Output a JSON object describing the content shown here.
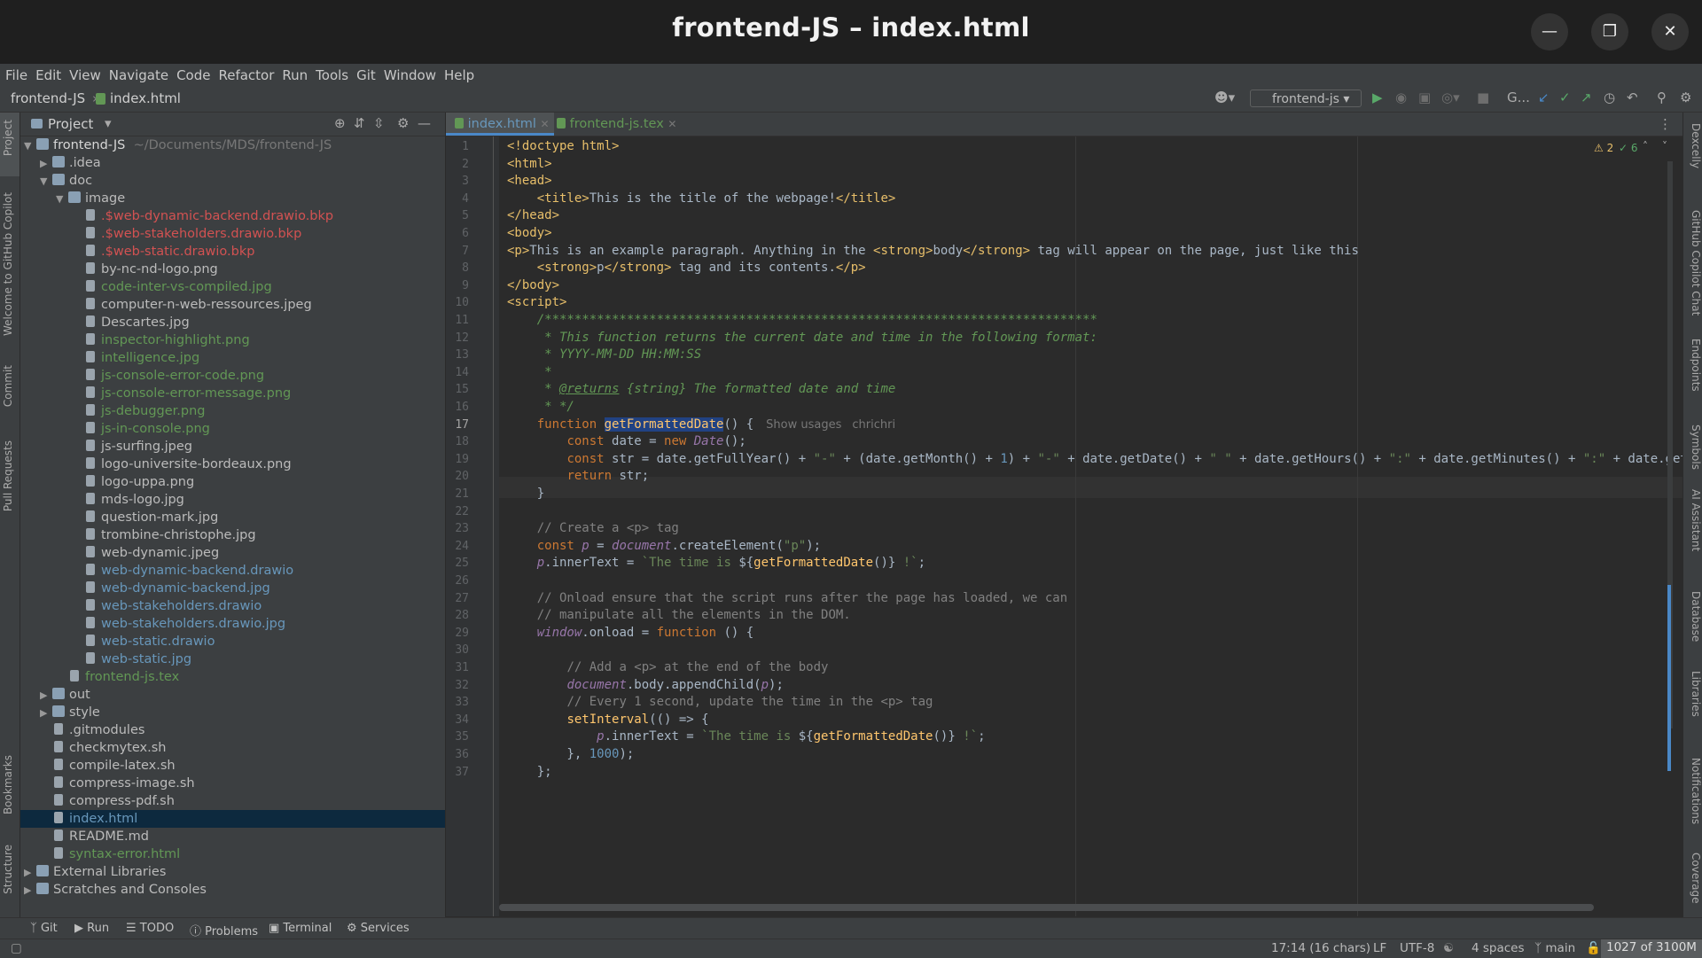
{
  "window": {
    "title": "frontend-JS – index.html"
  },
  "menu": [
    "File",
    "Edit",
    "View",
    "Navigate",
    "Code",
    "Refactor",
    "Run",
    "Tools",
    "Git",
    "Window",
    "Help"
  ],
  "breadcrumb": {
    "project": "frontend-JS",
    "file": "index.html"
  },
  "toolbar": {
    "run_config": "frontend-js",
    "git_label": "G..."
  },
  "left_tools": [
    "Project",
    "Welcome to GitHub Copilot",
    "Commit",
    "Pull Requests",
    "Bookmarks",
    "Structure"
  ],
  "right_tools": [
    "Dexcelly",
    "GitHub Copilot Chat",
    "Endpoints",
    "Symbols",
    "AI Assistant",
    "Database",
    "Libraries",
    "Notifications",
    "Coverage"
  ],
  "project_panel": {
    "title": "Project",
    "root": {
      "name": "frontend-JS",
      "path": "~/Documents/MDS/frontend-JS"
    },
    "items": [
      {
        "name": ".idea",
        "kind": "folder",
        "depth": 1,
        "arrow": "right",
        "color": "#bbbbbb"
      },
      {
        "name": "doc",
        "kind": "folder",
        "depth": 1,
        "arrow": "down",
        "color": "#bbbbbb"
      },
      {
        "name": "image",
        "kind": "folder",
        "depth": 2,
        "arrow": "down",
        "color": "#bbbbbb"
      },
      {
        "name": ".$web-dynamic-backend.drawio.bkp",
        "kind": "file",
        "depth": 3,
        "color": "#d25252"
      },
      {
        "name": ".$web-stakeholders.drawio.bkp",
        "kind": "file",
        "depth": 3,
        "color": "#d25252"
      },
      {
        "name": ".$web-static.drawio.bkp",
        "kind": "file",
        "depth": 3,
        "color": "#d25252"
      },
      {
        "name": "by-nc-nd-logo.png",
        "kind": "file",
        "depth": 3,
        "color": "#bbbbbb"
      },
      {
        "name": "code-inter-vs-compiled.jpg",
        "kind": "file",
        "depth": 3,
        "color": "#629755"
      },
      {
        "name": "computer-n-web-ressources.jpeg",
        "kind": "file",
        "depth": 3,
        "color": "#bbbbbb"
      },
      {
        "name": "Descartes.jpg",
        "kind": "file",
        "depth": 3,
        "color": "#bbbbbb"
      },
      {
        "name": "inspector-highlight.png",
        "kind": "file",
        "depth": 3,
        "color": "#629755"
      },
      {
        "name": "intelligence.jpg",
        "kind": "file",
        "depth": 3,
        "color": "#629755"
      },
      {
        "name": "js-console-error-code.png",
        "kind": "file",
        "depth": 3,
        "color": "#629755"
      },
      {
        "name": "js-console-error-message.png",
        "kind": "file",
        "depth": 3,
        "color": "#629755"
      },
      {
        "name": "js-debugger.png",
        "kind": "file",
        "depth": 3,
        "color": "#629755"
      },
      {
        "name": "js-in-console.png",
        "kind": "file",
        "depth": 3,
        "color": "#629755"
      },
      {
        "name": "js-surfing.jpeg",
        "kind": "file",
        "depth": 3,
        "color": "#bbbbbb"
      },
      {
        "name": "logo-universite-bordeaux.png",
        "kind": "file",
        "depth": 3,
        "color": "#bbbbbb"
      },
      {
        "name": "logo-uppa.png",
        "kind": "file",
        "depth": 3,
        "color": "#bbbbbb"
      },
      {
        "name": "mds-logo.jpg",
        "kind": "file",
        "depth": 3,
        "color": "#bbbbbb"
      },
      {
        "name": "question-mark.jpg",
        "kind": "file",
        "depth": 3,
        "color": "#bbbbbb"
      },
      {
        "name": "trombine-christophe.jpg",
        "kind": "file",
        "depth": 3,
        "color": "#bbbbbb"
      },
      {
        "name": "web-dynamic.jpeg",
        "kind": "file",
        "depth": 3,
        "color": "#bbbbbb"
      },
      {
        "name": "web-dynamic-backend.drawio",
        "kind": "file",
        "depth": 3,
        "color": "#6897bb"
      },
      {
        "name": "web-dynamic-backend.jpg",
        "kind": "file",
        "depth": 3,
        "color": "#6897bb"
      },
      {
        "name": "web-stakeholders.drawio",
        "kind": "file",
        "depth": 3,
        "color": "#6897bb"
      },
      {
        "name": "web-stakeholders.drawio.jpg",
        "kind": "file",
        "depth": 3,
        "color": "#6897bb"
      },
      {
        "name": "web-static.drawio",
        "kind": "file",
        "depth": 3,
        "color": "#6897bb"
      },
      {
        "name": "web-static.jpg",
        "kind": "file",
        "depth": 3,
        "color": "#6897bb"
      },
      {
        "name": "frontend-js.tex",
        "kind": "file",
        "depth": 2,
        "color": "#629755"
      },
      {
        "name": "out",
        "kind": "folder",
        "depth": 1,
        "arrow": "right",
        "color": "#bbbbbb"
      },
      {
        "name": "style",
        "kind": "folder",
        "depth": 1,
        "arrow": "right",
        "color": "#bbbbbb"
      },
      {
        "name": ".gitmodules",
        "kind": "file",
        "depth": 1,
        "color": "#bbbbbb"
      },
      {
        "name": "checkmytex.sh",
        "kind": "file",
        "depth": 1,
        "color": "#bbbbbb"
      },
      {
        "name": "compile-latex.sh",
        "kind": "file",
        "depth": 1,
        "color": "#bbbbbb"
      },
      {
        "name": "compress-image.sh",
        "kind": "file",
        "depth": 1,
        "color": "#bbbbbb"
      },
      {
        "name": "compress-pdf.sh",
        "kind": "file",
        "depth": 1,
        "color": "#bbbbbb"
      },
      {
        "name": "index.html",
        "kind": "file",
        "depth": 1,
        "color": "#6897bb",
        "selected": true
      },
      {
        "name": "README.md",
        "kind": "file",
        "depth": 1,
        "color": "#bbbbbb"
      },
      {
        "name": "syntax-error.html",
        "kind": "file",
        "depth": 1,
        "color": "#629755"
      },
      {
        "name": "External Libraries",
        "kind": "folder",
        "depth": 0,
        "arrow": "right",
        "color": "#bbbbbb"
      },
      {
        "name": "Scratches and Consoles",
        "kind": "folder",
        "depth": 0,
        "arrow": "right",
        "color": "#bbbbbb"
      }
    ]
  },
  "editor": {
    "tabs": [
      {
        "label": "index.html",
        "active": true
      },
      {
        "label": "frontend-js.tex",
        "active": false
      }
    ],
    "inspections": {
      "warnings": "2",
      "ok": "6"
    },
    "inlay": {
      "usages": "Show usages",
      "author": "chrichri"
    },
    "lines": [
      [
        [
          "t",
          "<!doctype html>"
        ]
      ],
      [
        [
          "t",
          "<html>"
        ]
      ],
      [
        [
          "t",
          "<head>"
        ]
      ],
      [
        [
          "p",
          "    "
        ],
        [
          "t",
          "<title>"
        ],
        [
          "p",
          "This is the title of the webpage!"
        ],
        [
          "t",
          "</title>"
        ]
      ],
      [
        [
          "t",
          "</head>"
        ]
      ],
      [
        [
          "t",
          "<body>"
        ]
      ],
      [
        [
          "t",
          "<p>"
        ],
        [
          "p",
          "This is an example paragraph. Anything in the "
        ],
        [
          "t",
          "<strong>"
        ],
        [
          "p",
          "body"
        ],
        [
          "t",
          "</strong>"
        ],
        [
          "p",
          " tag will appear on the page, just like this"
        ]
      ],
      [
        [
          "p",
          "    "
        ],
        [
          "t",
          "<strong>"
        ],
        [
          "p",
          "p"
        ],
        [
          "t",
          "</strong>"
        ],
        [
          "p",
          " tag and its contents."
        ],
        [
          "t",
          "</p>"
        ]
      ],
      [
        [
          "t",
          "</body>"
        ]
      ],
      [
        [
          "t",
          "<script>"
        ]
      ],
      [
        [
          "p",
          "    "
        ],
        [
          "c",
          "/**************************************************************************"
        ]
      ],
      [
        [
          "p",
          "    "
        ],
        [
          "c",
          " * This function returns the current date and time in the following format:"
        ]
      ],
      [
        [
          "p",
          "    "
        ],
        [
          "c",
          " * YYYY-MM-DD HH:MM:SS"
        ]
      ],
      [
        [
          "p",
          "    "
        ],
        [
          "c",
          " *"
        ]
      ],
      [
        [
          "p",
          "    "
        ],
        [
          "c",
          " * "
        ],
        [
          "c",
          "@returns"
        ],
        [
          "c",
          " {string} The formatted date and time"
        ]
      ],
      [
        [
          "p",
          "    "
        ],
        [
          "c",
          " * */"
        ]
      ],
      [
        [
          "p",
          "    "
        ],
        [
          "k",
          "function "
        ],
        [
          "fn",
          "getFormattedDate"
        ],
        [
          "p",
          "() {"
        ]
      ],
      [
        [
          "p",
          "        "
        ],
        [
          "k",
          "const "
        ],
        [
          "p",
          "date = "
        ],
        [
          "k",
          "new "
        ],
        [
          "g",
          "Date"
        ],
        [
          "p",
          "();"
        ]
      ],
      [
        [
          "p",
          "        "
        ],
        [
          "k",
          "const "
        ],
        [
          "p",
          "str = date.getFullYear() + "
        ],
        [
          "s",
          "\"-\""
        ],
        [
          "p",
          " + (date.getMonth() + "
        ],
        [
          "n",
          "1"
        ],
        [
          "p",
          ") + "
        ],
        [
          "s",
          "\"-\""
        ],
        [
          "p",
          " + date.getDate() + "
        ],
        [
          "s",
          "\" \""
        ],
        [
          "p",
          " + date.getHours() + "
        ],
        [
          "s",
          "\":\""
        ],
        [
          "p",
          " + date.getMinutes() + "
        ],
        [
          "s",
          "\":\""
        ],
        [
          "p",
          " + date.getSeconds"
        ]
      ],
      [
        [
          "p",
          "        "
        ],
        [
          "k",
          "return "
        ],
        [
          "p",
          "str;"
        ]
      ],
      [
        [
          "p",
          "    }"
        ]
      ],
      [
        [
          "p",
          ""
        ]
      ],
      [
        [
          "p",
          "    "
        ],
        [
          "cm",
          "// Create a <p> tag"
        ]
      ],
      [
        [
          "p",
          "    "
        ],
        [
          "k",
          "const "
        ],
        [
          "g",
          "p"
        ],
        [
          "p",
          " = "
        ],
        [
          "g",
          "document"
        ],
        [
          "p",
          ".createElement("
        ],
        [
          "s",
          "\"p\""
        ],
        [
          "p",
          ");"
        ]
      ],
      [
        [
          "p",
          "    "
        ],
        [
          "g",
          "p"
        ],
        [
          "p",
          ".innerText = "
        ],
        [
          "s",
          "`The time is "
        ],
        [
          "p",
          "${"
        ],
        [
          "fn",
          "getFormattedDate"
        ],
        [
          "p",
          "()}"
        ],
        [
          "s",
          " !`"
        ],
        [
          "p",
          ";"
        ]
      ],
      [
        [
          "p",
          ""
        ]
      ],
      [
        [
          "p",
          "    "
        ],
        [
          "cm",
          "// Onload ensure that the script runs after the page has loaded, we can"
        ]
      ],
      [
        [
          "p",
          "    "
        ],
        [
          "cm",
          "// manipulate all the elements in the DOM."
        ]
      ],
      [
        [
          "p",
          "    "
        ],
        [
          "g",
          "window"
        ],
        [
          "p",
          ".onload = "
        ],
        [
          "k",
          "function "
        ],
        [
          "p",
          "() {"
        ]
      ],
      [
        [
          "p",
          ""
        ]
      ],
      [
        [
          "p",
          "        "
        ],
        [
          "cm",
          "// Add a <p> at the end of the body"
        ]
      ],
      [
        [
          "p",
          "        "
        ],
        [
          "g",
          "document"
        ],
        [
          "p",
          ".body.appendChild("
        ],
        [
          "g",
          "p"
        ],
        [
          "p",
          ");"
        ]
      ],
      [
        [
          "p",
          "        "
        ],
        [
          "cm",
          "// Every 1 second, update the time in the <p> tag"
        ]
      ],
      [
        [
          "p",
          "        "
        ],
        [
          "fn",
          "setInterval"
        ],
        [
          "p",
          "(() => {"
        ]
      ],
      [
        [
          "p",
          "            "
        ],
        [
          "g",
          "p"
        ],
        [
          "p",
          ".innerText = "
        ],
        [
          "s",
          "`The time is "
        ],
        [
          "p",
          "${"
        ],
        [
          "fn",
          "getFormattedDate"
        ],
        [
          "p",
          "()}"
        ],
        [
          "s",
          " !`"
        ],
        [
          "p",
          ";"
        ]
      ],
      [
        [
          "p",
          "        }, "
        ],
        [
          "n",
          "1000"
        ],
        [
          "p",
          ");"
        ]
      ],
      [
        [
          "p",
          "    };"
        ]
      ]
    ]
  },
  "bottom_tools": [
    "Git",
    "Run",
    "TODO",
    "Problems",
    "Terminal",
    "Services"
  ],
  "status": {
    "position": "17:14 (16 chars)",
    "line_sep": "LF",
    "encoding": "UTF-8",
    "indent": "4 spaces",
    "branch": "main",
    "memory": "1027 of 3100M"
  },
  "colors": {
    "selection": "#0d293e",
    "accent": "#4a88c7"
  }
}
